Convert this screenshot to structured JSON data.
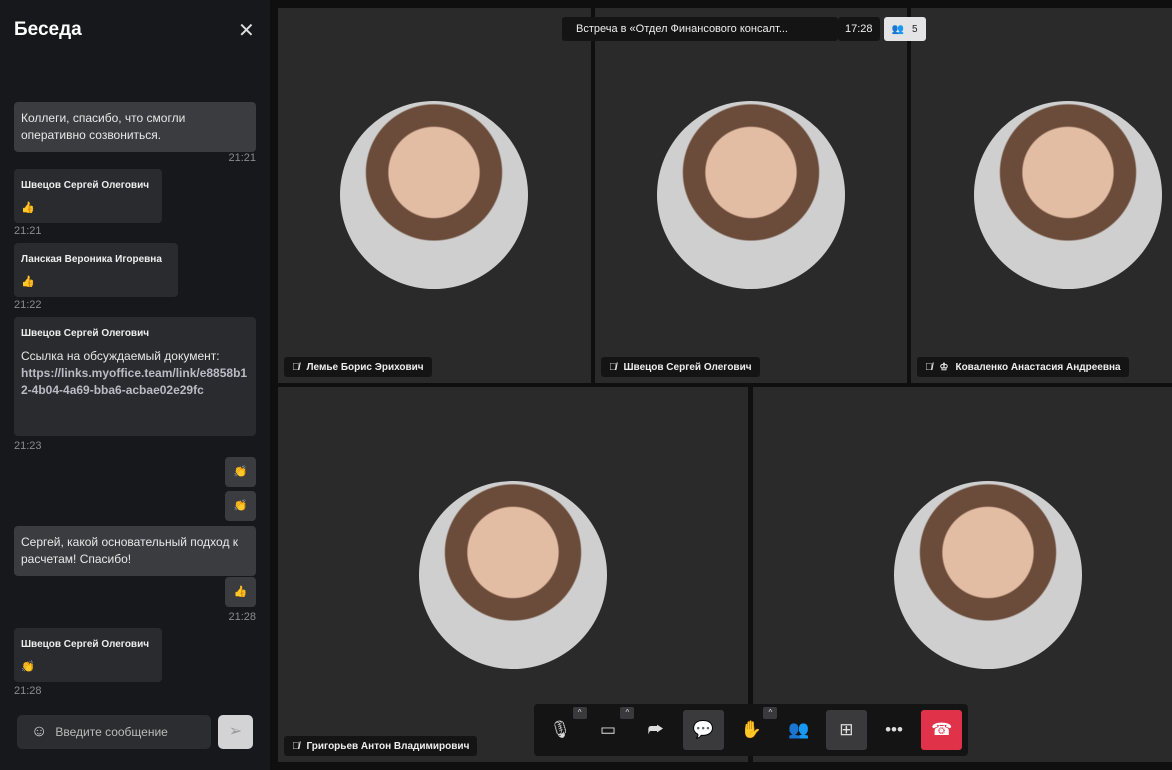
{
  "chat": {
    "title": "Беседа",
    "close_icon": "close-icon",
    "messages": [
      {
        "text": "Коллеги, спасибо, что смогли оперативно созвониться.",
        "time": "21:21"
      },
      {
        "author": "Швецов Сергей Олегович",
        "text": "👍",
        "time": "21:21"
      },
      {
        "author": "Ланская Вероника Игоревна",
        "text": "👍",
        "time": "21:22"
      },
      {
        "author": "Швецов Сергей Олегович",
        "text": "Ссылка на обсуждаемый документ:",
        "link": "https://links.myoffice.team/link/e8858b12-4b04-4a69-bba6-acbae02e29fc",
        "time": "21:23"
      },
      {
        "text": "👏"
      },
      {
        "text": "👏"
      },
      {
        "text": "Сергей, какой основательный подход к расчетам! Спасибо!"
      },
      {
        "text": "👍",
        "time": "21:28"
      },
      {
        "author": "Швецов Сергей Олегович",
        "text": "👏",
        "time": "21:28"
      }
    ],
    "input_placeholder": "Введите сообщение"
  },
  "meeting": {
    "title": "Встреча в «Отдел Финансового консалт...",
    "duration": "17:28",
    "participants": "5"
  },
  "tiles": [
    {
      "name": "Лемье Борис Эрихович"
    },
    {
      "name": "Швецов Сергей Олегович"
    },
    {
      "name": "Коваленко Анастасия Андреевна"
    },
    {
      "name": "Григорьев Антон Владимирович"
    },
    {
      "name": ""
    }
  ],
  "colors": {
    "end_call": "#e0334a"
  }
}
